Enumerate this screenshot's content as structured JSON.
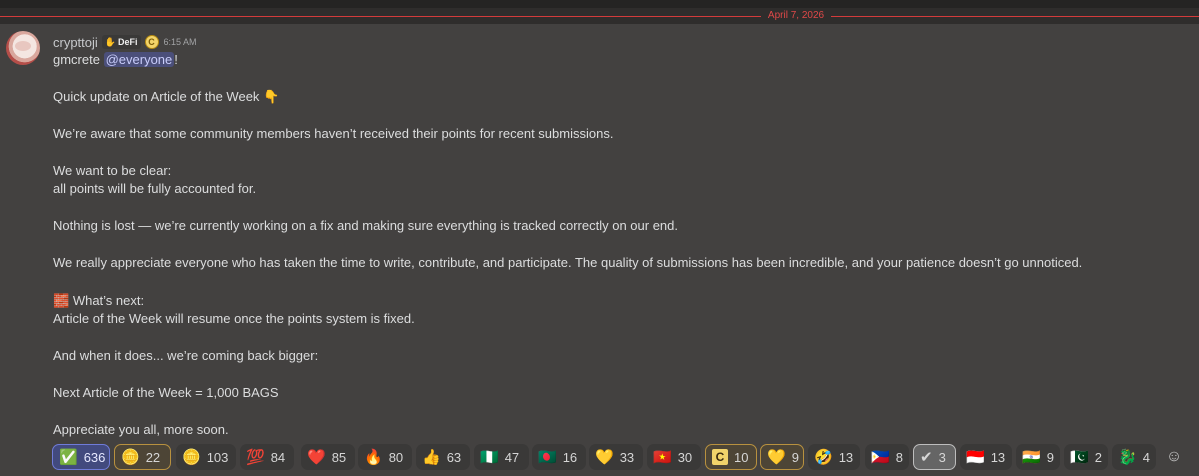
{
  "date_divider": "April 7, 2026",
  "message": {
    "username": "crypttoji",
    "role": "DeFi",
    "coin_badge": "C",
    "timestamp": "6:15 AM",
    "greeting": "gmcrete",
    "mention": "@everyone",
    "greeting_end": "!",
    "line_update": "Quick update on Article of the Week",
    "line_update_emoji": "👇",
    "line_aware": "We’re aware that some community members haven’t received their points for recent submissions.",
    "line_clear1": "We want to be clear:",
    "line_clear2": "all points will be fully accounted for.",
    "line_nothing": "Nothing is lost — we’re currently working on a fix and making sure everything is tracked correctly on our end.",
    "line_appreciate": "We really appreciate everyone who has taken the time to write, contribute, and participate. The quality of submissions has been incredible, and your patience doesn’t go unnoticed.",
    "line_next_emoji": "🧱",
    "line_next": "What’s next:",
    "line_resume": "Article of the Week will resume once the points system is fixed.",
    "line_bigger": "And when it does... we’re coming back bigger:",
    "line_reward": "Next Article of the Week = 1,000 BAGS",
    "line_soon": "Appreciate you all, more soon."
  },
  "reactions": [
    {
      "icon": "✅",
      "count": "636"
    },
    {
      "icon": "🪙",
      "count": "22"
    },
    {
      "icon": "🪙",
      "count": "103"
    },
    {
      "icon": "💯",
      "count": "84"
    },
    {
      "icon": "❤️",
      "count": "85"
    },
    {
      "icon": "🔥",
      "count": "80"
    },
    {
      "icon": "👍",
      "count": "63"
    },
    {
      "icon": "🇳🇬",
      "count": "47"
    },
    {
      "icon": "🇧🇩",
      "count": "16"
    },
    {
      "icon": "💛",
      "count": "33"
    },
    {
      "icon": "🇻🇳",
      "count": "30"
    },
    {
      "icon": "C",
      "count": "10"
    },
    {
      "icon": "💛",
      "count": "9"
    },
    {
      "icon": "🤣",
      "count": "13"
    },
    {
      "icon": "🇵🇭",
      "count": "8"
    },
    {
      "icon": "✔",
      "count": "3"
    },
    {
      "icon": "🇮🇩",
      "count": "13"
    },
    {
      "icon": "🇮🇳",
      "count": "9"
    },
    {
      "icon": "🇵🇰",
      "count": "2"
    },
    {
      "icon": "🐉",
      "count": "4"
    }
  ],
  "add_reaction_icon": "☺"
}
